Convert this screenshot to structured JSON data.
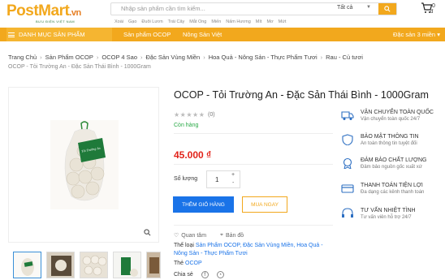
{
  "header": {
    "logo": "PostMart",
    "logo_tld": ".vn",
    "logo_tagline": "BƯU ĐIỆN VIỆT NAM",
    "search_placeholder": "Nhập sản phẩm cần tìm kiếm...",
    "search_category": "Tất cả",
    "quick_links": [
      "Xoài",
      "Gạo",
      "Đuôi Lươn",
      "Trái Cây",
      "Mắt Ong",
      "Miến",
      "Nấm Hương",
      "Mít",
      "Mơ",
      "Mứt"
    ],
    "cart_count": "0",
    "cart_label": "đ"
  },
  "nav": {
    "menu_label": "DANH MỤC SẢN PHẨM",
    "link1": "Sản phẩm OCOP",
    "link2": "Nông Sản Việt",
    "right": "Đặc sản 3 miền"
  },
  "breadcrumb": {
    "items": [
      "Trang Chủ",
      "Sản Phẩm OCOP",
      "OCOP 4 Sao",
      "Đặc Sản Vùng Miền",
      "Hoa Quả - Nông Sản - Thực Phẩm Tươi",
      "Rau - Củ tươi"
    ],
    "sep": "›",
    "current": "OCOP - Tỏi Trường An - Đặc Sản Thái Bình - 1000Gram"
  },
  "product": {
    "title": "OCOP - Tỏi Trường An - Đặc Sản Thái Bình - 1000Gram",
    "rating": 0,
    "reviews": "(0)",
    "stock": "Còn hàng",
    "price": "45.000 ₫",
    "qty_label": "Số lượng",
    "qty_value": "1",
    "qty_up": "+",
    "qty_down": "-",
    "add_to_cart": "THÊM GIỎ HÀNG",
    "buy_now": "MUA NGAY",
    "favorite": "Quan tâm",
    "share": "Bản đồ",
    "category_label": "Thể loại",
    "categories": "Sản Phẩm OCOP, Đặc Sản Vùng Miền, Hoa Quả - Nông Sản - Thực Phẩm Tươi",
    "tag_label": "Thẻ",
    "tag": "OCOP",
    "share_label": "Chia sẻ",
    "package_text": "Tỏi Trường An"
  },
  "services": [
    {
      "icon": "truck-icon",
      "title": "VẬN CHUYỂN TOÀN QUỐC",
      "sub": "Vận chuyển toàn quốc 24/7"
    },
    {
      "icon": "shield-icon",
      "title": "BẢO MẬT THÔNG TIN",
      "sub": "An toàn thông tin tuyệt đối"
    },
    {
      "icon": "badge-icon",
      "title": "ĐẢM BẢO CHẤT LƯỢNG",
      "sub": "Đảm bảo nguồn gốc xuất xứ"
    },
    {
      "icon": "card-icon",
      "title": "THANH TOÁN TIỆN LỢI",
      "sub": "Đa dạng các kênh thanh toán"
    },
    {
      "icon": "headset-icon",
      "title": "TƯ VẤN NHIỆT TÌNH",
      "sub": "Tư vấn viên hỗ trợ 24/7"
    }
  ],
  "colors": {
    "brand_orange": "#f2a81d",
    "price_red": "#e2231a",
    "primary_blue": "#1a73e8",
    "stock_green": "#27a844"
  }
}
